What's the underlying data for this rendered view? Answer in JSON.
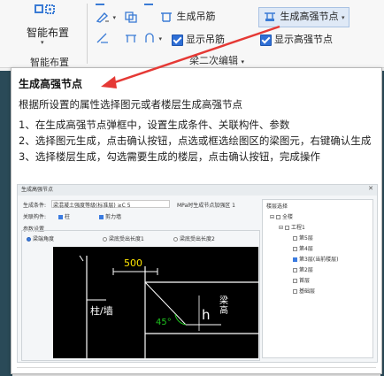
{
  "ribbon": {
    "smart_layout_label": "智能布置",
    "smart_layout_group": "智能布置",
    "generate_hanger": "生成吊筋",
    "generate_strong_node": "生成高强节点",
    "show_hanger": "显示吊筋",
    "show_strong_node": "显示高强节点",
    "second_edit_group": "梁二次编辑"
  },
  "tooltip": {
    "title": "生成高强节点",
    "description": "根据所设置的属性选择图元或者楼层生成高强节点",
    "steps": [
      "1、在生成高强节点弹框中，设置生成条件、关联构件、参数",
      "2、选择图元生成，点击确认按钮，点选或框选绘图区的梁图元，右键确认生成",
      "3、选择楼层生成，勾选需要生成的楼层，点击确认按钮，完成操作"
    ]
  },
  "dialog": {
    "title": "生成高强节点",
    "rows": {
      "condition_label": "生成条件:",
      "condition_value": "梁混凝土强度等级(标准层) ≥C 5",
      "related_label": "关联构件:",
      "column": "柱",
      "wall": "剪力墙",
      "param_label": "参数设置",
      "mpa_label": "MPa时生成节点加强区 1"
    },
    "radios": [
      "梁端角度",
      "梁底受出长度1",
      "梁底受出长度2"
    ],
    "drawing": {
      "dim_500": "500",
      "col_wall": "柱/墙",
      "angle": "45°",
      "h": "h",
      "beam_height": "梁高"
    },
    "tree": {
      "header": "楼层选择",
      "all": "全楼",
      "project": "工程1",
      "floors": [
        "第5层",
        "第4层",
        "第3层(当前楼层)",
        "第2层",
        "首层",
        "基础层"
      ]
    }
  }
}
